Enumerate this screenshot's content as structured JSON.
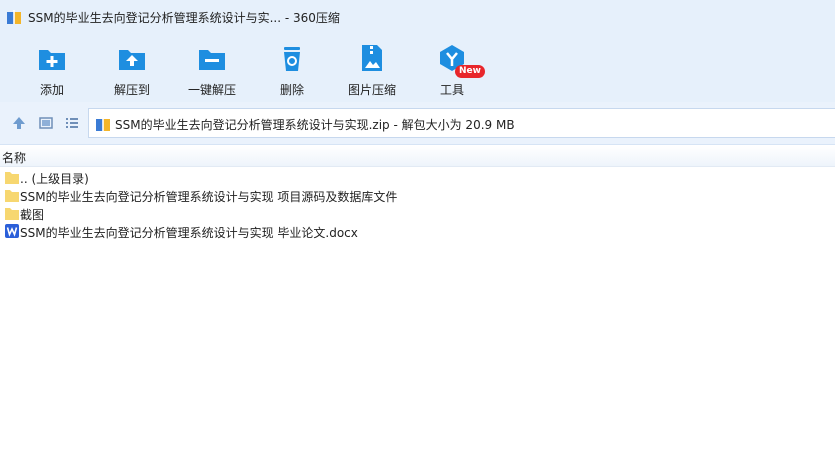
{
  "window": {
    "title": "SSM的毕业生去向登记分析管理系统设计与实... - 360压缩"
  },
  "toolbar": {
    "buttons": [
      {
        "label": "添加",
        "icon": "add-icon"
      },
      {
        "label": "解压到",
        "icon": "extract-to-icon"
      },
      {
        "label": "一键解压",
        "icon": "one-click-extract-icon"
      },
      {
        "label": "删除",
        "icon": "delete-icon"
      },
      {
        "label": "图片压缩",
        "icon": "image-compress-icon"
      },
      {
        "label": "工具",
        "icon": "tools-icon"
      }
    ],
    "new_badge": "New"
  },
  "address": {
    "path": "SSM的毕业生去向登记分析管理系统设计与实现.zip - 解包大小为 20.9 MB"
  },
  "list": {
    "header": "名称",
    "items": [
      {
        "name": ".. (上级目录)",
        "type": "folder"
      },
      {
        "name": "SSM的毕业生去向登记分析管理系统设计与实现 项目源码及数据库文件",
        "type": "folder"
      },
      {
        "name": "截图",
        "type": "folder"
      },
      {
        "name": "SSM的毕业生去向登记分析管理系统设计与实现 毕业论文.docx",
        "type": "word"
      }
    ]
  },
  "colors": {
    "accent": "#1e8ee0",
    "badge": "#e8262b",
    "folder": "#f7d770",
    "word": "#2b5fd9"
  }
}
